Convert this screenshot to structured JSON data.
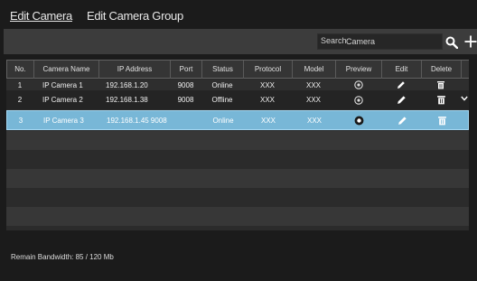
{
  "tabs": [
    {
      "label": "Edit Camera",
      "active": true
    },
    {
      "label": "Edit Camera Group",
      "active": false
    }
  ],
  "search": {
    "label": "Search",
    "placeholder": "Camera"
  },
  "table": {
    "columns": [
      "No.",
      "Camera Name",
      "IP Address",
      "Port",
      "Status",
      "Protocol",
      "Model",
      "Preview",
      "Edit",
      "Delete"
    ],
    "rows": [
      {
        "no": "1",
        "name": "IP Camera 1",
        "ip": "192.168.1.20",
        "port": "9008",
        "status": "Online",
        "protocol": "XXX",
        "model": "XXX",
        "selected": false
      },
      {
        "no": "2",
        "name": "IP Camera 2",
        "ip": "192.168.1.38",
        "port": "9008",
        "status": "Offline",
        "protocol": "XXX",
        "model": "XXX",
        "selected": false
      },
      {
        "no": "3",
        "name": "IP Camera 3",
        "ip": "192.168.1.45 9008",
        "port": "",
        "status": "Online",
        "protocol": "XXX",
        "model": "XXX",
        "selected": true
      }
    ]
  },
  "footer": {
    "bandwidth": "Remain Bandwidth: 85 / 120 Mb"
  },
  "colors": {
    "background": "#1b1b1b",
    "toolbar": "#3c3c3c",
    "selected_row": "#78b7d7",
    "selected_border": "#a5d8f2"
  },
  "icons": {
    "search": "search-icon",
    "add": "plus-icon",
    "preview": "preview-icon",
    "edit": "pencil-icon",
    "delete": "trash-icon",
    "expand": "chevron-down-icon"
  }
}
